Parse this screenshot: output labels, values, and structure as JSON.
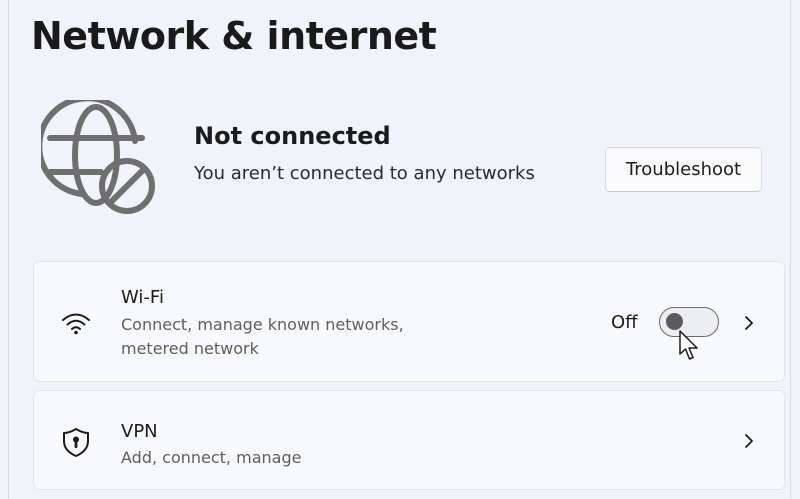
{
  "page": {
    "title": "Network & internet"
  },
  "status": {
    "icon": "globe-blocked-icon",
    "title": "Not connected",
    "subtitle": "You aren’t connected to any networks",
    "troubleshoot_label": "Troubleshoot"
  },
  "settings": [
    {
      "id": "wifi",
      "icon": "wifi-icon",
      "title": "Wi-Fi",
      "description": "Connect, manage known networks, metered network",
      "toggle_state": "Off",
      "toggle_on": false
    },
    {
      "id": "vpn",
      "icon": "shield-icon",
      "title": "VPN",
      "description": "Add, connect, manage"
    }
  ],
  "colors": {
    "background": "#f0f3f9",
    "card": "#f8f9fc",
    "text_primary": "#1b1b1b",
    "text_secondary": "#5e5e5e",
    "icon_gray": "#6f6f6f"
  }
}
